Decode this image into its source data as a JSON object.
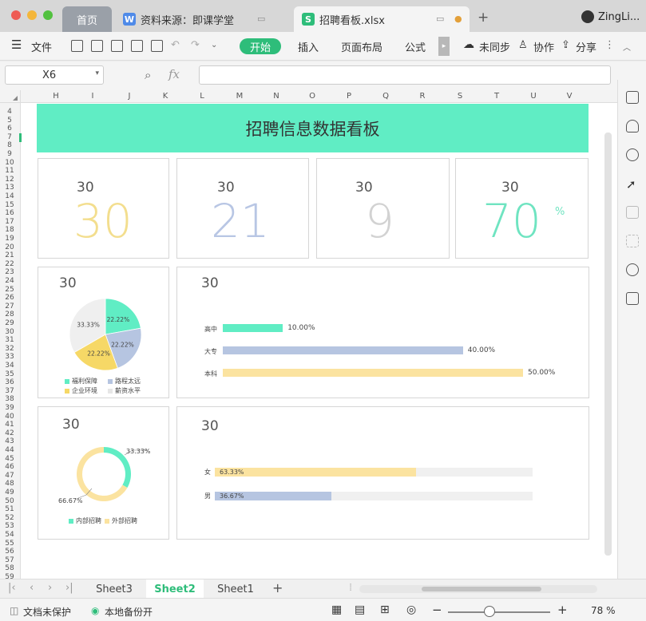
{
  "window": {
    "tabs": [
      {
        "label": "首页"
      },
      {
        "label": "资料来源：即课学堂"
      },
      {
        "label": "招聘看板.xlsx"
      }
    ],
    "user": "ZingLi..."
  },
  "toolbar": {
    "file": "文件",
    "tabs": [
      "开始",
      "插入",
      "页面布局",
      "公式"
    ],
    "sync": "未同步",
    "collab": "协作",
    "share": "分享"
  },
  "formula_bar": {
    "cell_ref": "X6",
    "fx": "fx",
    "value": ""
  },
  "columns": [
    "H",
    "I",
    "J",
    "K",
    "L",
    "M",
    "N",
    "O",
    "P",
    "Q",
    "R",
    "S",
    "T",
    "U",
    "V"
  ],
  "rows": [
    "4",
    "5",
    "6",
    "7",
    "8",
    "9",
    "10",
    "11",
    "12",
    "13",
    "14",
    "15",
    "16",
    "17",
    "18",
    "19",
    "20",
    "21",
    "22",
    "23",
    "24",
    "25",
    "26",
    "27",
    "28",
    "29",
    "30",
    "31",
    "32",
    "33",
    "34",
    "35",
    "36",
    "37",
    "38",
    "39",
    "40",
    "41",
    "42",
    "43",
    "44",
    "45",
    "46",
    "47",
    "48",
    "49",
    "50",
    "51",
    "52",
    "53",
    "54",
    "55",
    "56",
    "57",
    "58",
    "59"
  ],
  "dashboard": {
    "title": "招聘信息数据看板",
    "kpis": [
      {
        "small": "30",
        "big": "30",
        "color": "#f3de8e"
      },
      {
        "small": "30",
        "big": "21",
        "color": "#b8c6e4"
      },
      {
        "small": "30",
        "big": "9",
        "color": "#d2d2d2"
      },
      {
        "small": "30",
        "big": "70",
        "unit": "%",
        "color": "#6fe4c1"
      }
    ],
    "pie_card": {
      "small": "30",
      "slices": [
        {
          "label": "22.22%",
          "legend": "福利保障",
          "value": 22.22,
          "color": "#60edc4"
        },
        {
          "label": "22.22%",
          "legend": "路程太远",
          "value": 22.22,
          "color": "#b6c5e1"
        },
        {
          "label": "22.22%",
          "legend": "企业环境",
          "value": 22.22,
          "color": "#f6d866"
        },
        {
          "label": "33.33%",
          "legend": "薪资水平",
          "value": 33.33,
          "color": "#efefef"
        }
      ]
    },
    "edu_card": {
      "small": "30",
      "bars": [
        {
          "label": "高中",
          "value": 10.0,
          "value_label": "10.00%",
          "color": "#60edc4"
        },
        {
          "label": "大专",
          "value": 40.0,
          "value_label": "40.00%",
          "color": "#b6c5e1"
        },
        {
          "label": "本科",
          "value": 50.0,
          "value_label": "50.00%",
          "color": "#fbe3a0"
        }
      ]
    },
    "donut_card": {
      "small": "30",
      "slices": [
        {
          "label": "33.33%",
          "legend": "内部招聘",
          "value": 33.33,
          "color": "#60edc4"
        },
        {
          "label": "66.67%",
          "legend": "外部招聘",
          "value": 66.67,
          "color": "#fbe3a0"
        }
      ]
    },
    "gender_card": {
      "small": "30",
      "bars": [
        {
          "label": "女",
          "value": 63.33,
          "value_label": "63.33%",
          "color": "#fbe3a0"
        },
        {
          "label": "男",
          "value": 36.67,
          "value_label": "36.67%",
          "color": "#b6c5e1"
        }
      ]
    }
  },
  "sheet_tabs": [
    "Sheet3",
    "Sheet2",
    "Sheet1"
  ],
  "active_sheet": "Sheet2",
  "status": {
    "protect": "文档未保护",
    "backup": "本地备份开",
    "zoom": "78 %"
  }
}
